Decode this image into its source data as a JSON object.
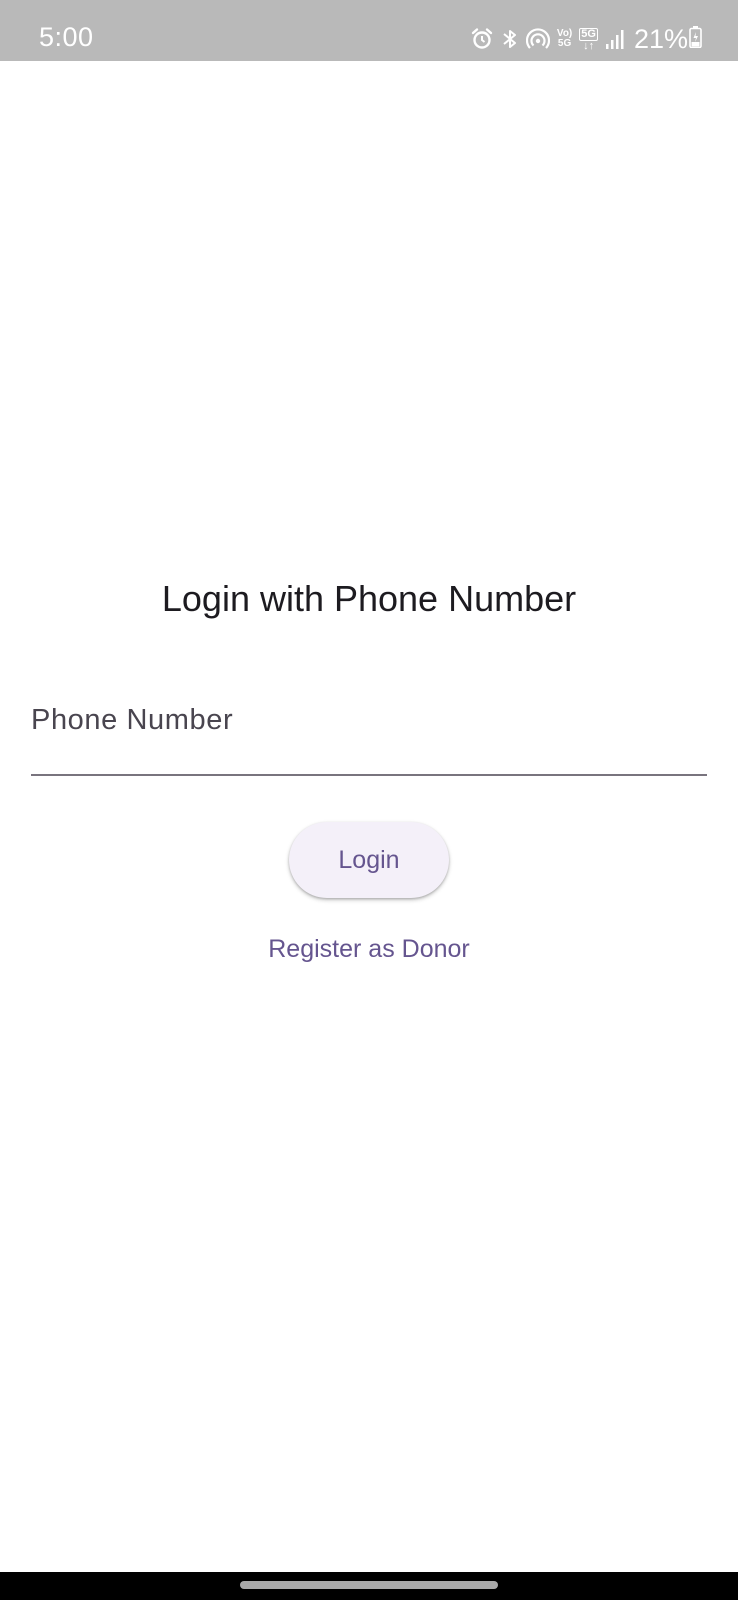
{
  "status_bar": {
    "time": "5:00",
    "volte_top": "Vo)",
    "volte_bottom": "5G",
    "network_type": "5G",
    "battery_percent": "21%",
    "icons": [
      "alarm-icon",
      "bluetooth-icon",
      "hotspot-icon",
      "volte-icon",
      "network-5g-icon",
      "signal-icon",
      "battery-icon"
    ]
  },
  "login": {
    "title": "Login with Phone Number",
    "phone_placeholder": "Phone Number",
    "phone_value": "",
    "login_button_label": "Login",
    "register_link_label": "Register as Donor"
  },
  "colors": {
    "accent": "#65558f",
    "button_bg": "#f4f0f9",
    "status_bar_bg": "#b9b9b9"
  }
}
